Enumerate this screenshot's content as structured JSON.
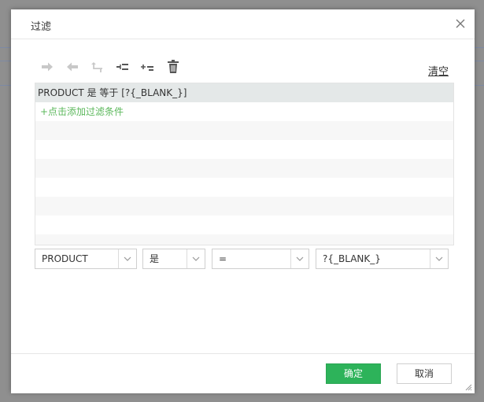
{
  "dialog": {
    "title": "过滤",
    "close_icon": "close-icon"
  },
  "toolbar": {
    "buttons": [
      {
        "name": "indent-right-button",
        "icon": "arrow-right-icon"
      },
      {
        "name": "indent-left-button",
        "icon": "arrow-left-icon"
      },
      {
        "name": "move-up-button",
        "icon": "corner-up-icon"
      },
      {
        "name": "insert-below-button",
        "icon": "insert-below-icon"
      },
      {
        "name": "insert-above-button",
        "icon": "insert-above-icon"
      },
      {
        "name": "delete-button",
        "icon": "trash-icon"
      }
    ],
    "clear_label": "清空"
  },
  "conditions": {
    "selected": "PRODUCT 是 等于 [?{_BLANK_}]",
    "add_label": "+点击添加过滤条件"
  },
  "editor": {
    "field": "PRODUCT",
    "relation": "是",
    "operator": "=",
    "value": "?{_BLANK_}"
  },
  "footer": {
    "ok_label": "确定",
    "cancel_label": "取消"
  },
  "colors": {
    "ok_button": "#2db35a",
    "add_link": "#5cb85c",
    "selected_row": "#e4e8e8"
  }
}
